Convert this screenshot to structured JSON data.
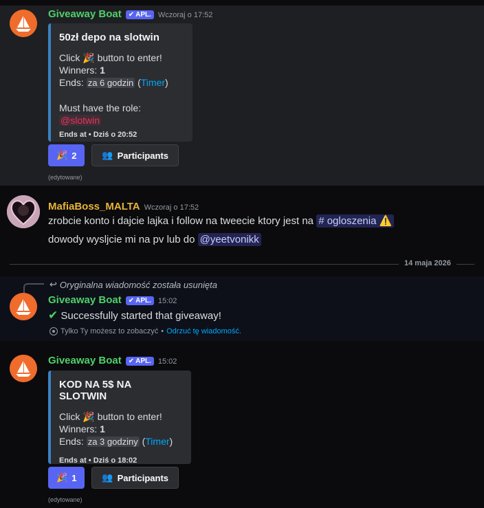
{
  "messages": [
    {
      "author": "Giveaway Boat",
      "app_tag": "APL.",
      "timestamp": "Wczoraj o 17:52",
      "embed": {
        "title": "50zł depo na slotwin",
        "click_pre": "Click",
        "click_post": "button to enter!",
        "winners_label": "Winners:",
        "winners_value": "1",
        "ends_label": "Ends:",
        "ends_value": "za 6 godzin",
        "timer_open": "(",
        "timer_link": "Timer",
        "timer_close": ")",
        "role_label": "Must have the role:",
        "role_value": "@slotwin",
        "ends_at": "Ends at • Dziś o 20:52"
      },
      "enter_count": "2",
      "participants_label": "Participants",
      "edited": "(edytowane)"
    },
    {
      "author": "MafiaBoss_MALTA",
      "timestamp": "Wczoraj o 17:52",
      "line1_pre": "zrobcie konto i dajcie lajka i follow na tweecie ktory jest na",
      "channel": "ogloszenia",
      "line2_pre": "dowody wysljcie mi na pv lub do",
      "mention": "@yeetvonikk"
    },
    {
      "reply_text": "Oryginalna wiadomość została usunięta",
      "author": "Giveaway Boat",
      "app_tag": "APL.",
      "timestamp": "15:02",
      "content": "Successfully started that giveaway!",
      "ephemeral_note": "Tylko Ty możesz to zobaczyć",
      "ephemeral_sep": "•",
      "dismiss": "Odrzuć tę wiadomość."
    },
    {
      "author": "Giveaway Boat",
      "app_tag": "APL.",
      "timestamp": "15:02",
      "embed": {
        "title": "KOD NA 5$ NA SLOTWIN",
        "click_pre": "Click",
        "click_post": "button to enter!",
        "winners_label": "Winners:",
        "winners_value": "1",
        "ends_label": "Ends:",
        "ends_value": "za 3 godziny",
        "timer_open": "(",
        "timer_link": "Timer",
        "timer_close": ")",
        "ends_at": "Ends at • Dziś o 18:02"
      },
      "enter_count": "1",
      "participants_label": "Participants",
      "edited": "(edytowane)"
    }
  ],
  "date_divider": "14 maja 2026",
  "icons": {
    "party": "party-popper-icon",
    "participants": "people-icon",
    "reply": "reply-arrow-icon",
    "eye": "eye-icon",
    "check": "check-mark-icon",
    "warning": "warning-icon",
    "channel": "hash-icon"
  },
  "colors": {
    "bot_name": "#4fd06a",
    "mafia_name": "#e8b33a",
    "app_tag": "#5865f2",
    "embed_border": "#3b82c4",
    "link": "#00a8fc",
    "role": "#e5335a"
  }
}
